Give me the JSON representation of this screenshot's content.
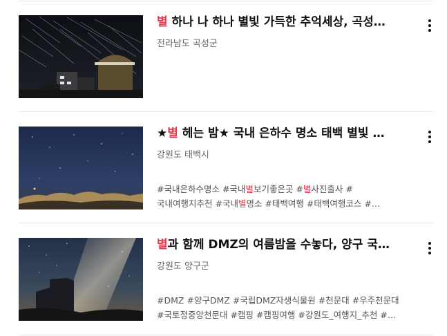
{
  "items": [
    {
      "title_hl": "별",
      "title_rest": " 하나 나 하나 별빛 가득한 추억세상, 곡성…",
      "location": "전라남도 곡성군"
    },
    {
      "title_pre": "★",
      "title_hl": "별",
      "title_rest": " 헤는 밤★ 국내 은하수 명소 태백 별빛 …",
      "location": "강원도 태백시",
      "tags_line1": {
        "a": "#국내은하수명소 #국내",
        "hl": "별",
        "b": "보기좋은곳 #",
        "hl2": "별",
        "c": "사진출사 #"
      },
      "tags_line2": {
        "a": "국내여행지추천 #국내",
        "hl": "별",
        "b": "명소 #태백여행 #태백여행코스 #…"
      }
    },
    {
      "title_hl": "별",
      "title_rest": "과 함께 DMZ의 여름밤을 수놓다, 양구 국…",
      "location": "강원도 양구군",
      "tags_line1": "#DMZ #양구DMZ #국립DMZ자생식물원 #천문대 #우주천문대",
      "tags_line2": "#국토정중앙천문대 #캠핑 #캠핑여행 #강원도_여행지_추천 #…"
    }
  ],
  "colors": {
    "highlight": "#e8374a",
    "divider": "#e6e6e6"
  }
}
